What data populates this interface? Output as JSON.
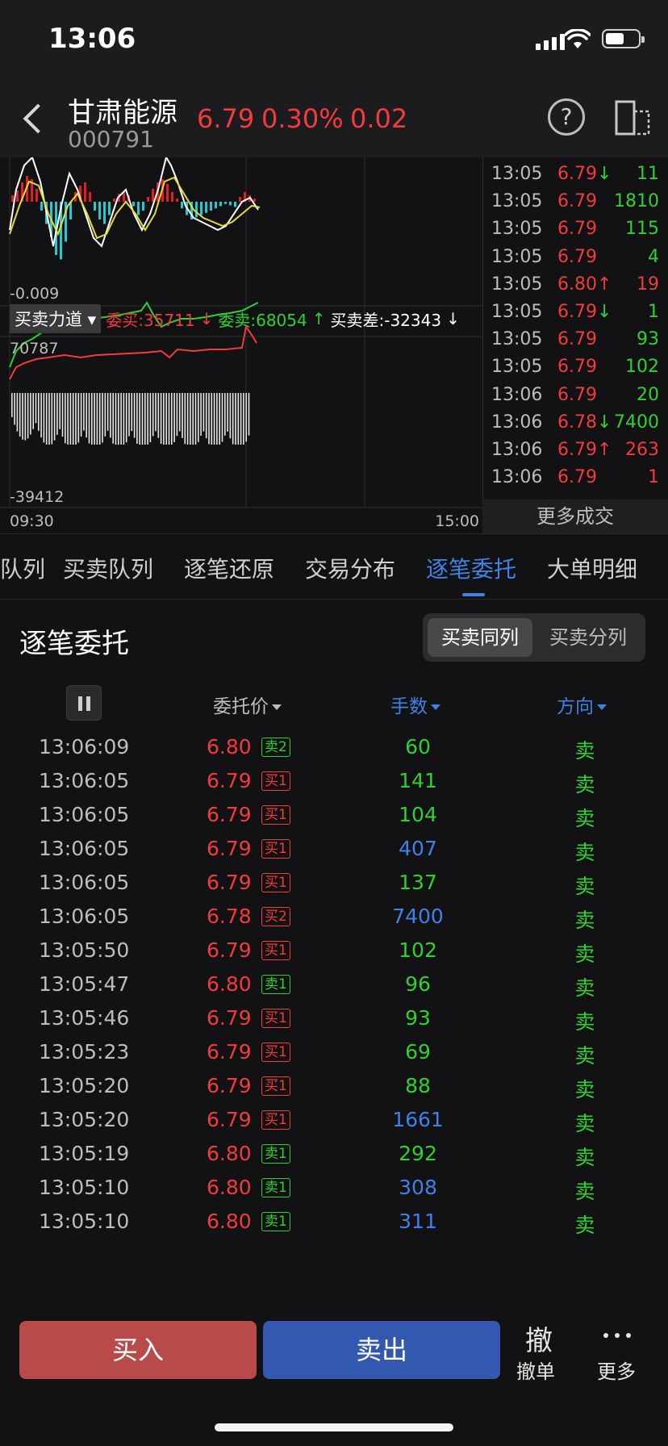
{
  "status_bar": {
    "time": "13:06"
  },
  "header": {
    "stock_name": "甘肃能源",
    "stock_code": "000791",
    "price": "6.79",
    "change_pct": "0.30%",
    "change": "0.02"
  },
  "chart": {
    "macd_min_label": "-0.009",
    "indicator_name": "买卖力道",
    "bid_label": "委买:35711",
    "ask_label": "委卖:68054",
    "diff_label": "买卖差:-32343",
    "power_max_label": "70787",
    "power_min_label": "-39412",
    "time_start": "09:30",
    "time_end": "15:00"
  },
  "ticks": [
    {
      "time": "13:05",
      "price": "6.79",
      "arrow": "↓",
      "vol": "11",
      "price_color": "red",
      "vol_color": "green"
    },
    {
      "time": "13:05",
      "price": "6.79",
      "arrow": "",
      "vol": "1810",
      "price_color": "red",
      "vol_color": "green"
    },
    {
      "time": "13:05",
      "price": "6.79",
      "arrow": "",
      "vol": "115",
      "price_color": "red",
      "vol_color": "green"
    },
    {
      "time": "13:05",
      "price": "6.79",
      "arrow": "",
      "vol": "4",
      "price_color": "red",
      "vol_color": "green"
    },
    {
      "time": "13:05",
      "price": "6.80",
      "arrow": "↑",
      "vol": "19",
      "price_color": "red",
      "vol_color": "red"
    },
    {
      "time": "13:05",
      "price": "6.79",
      "arrow": "↓",
      "vol": "1",
      "price_color": "red",
      "vol_color": "green"
    },
    {
      "time": "13:05",
      "price": "6.79",
      "arrow": "",
      "vol": "93",
      "price_color": "red",
      "vol_color": "green"
    },
    {
      "time": "13:05",
      "price": "6.79",
      "arrow": "",
      "vol": "102",
      "price_color": "red",
      "vol_color": "green"
    },
    {
      "time": "13:06",
      "price": "6.79",
      "arrow": "",
      "vol": "20",
      "price_color": "red",
      "vol_color": "green"
    },
    {
      "time": "13:06",
      "price": "6.78",
      "arrow": "↓",
      "vol": "7400",
      "price_color": "red",
      "vol_color": "green"
    },
    {
      "time": "13:06",
      "price": "6.79",
      "arrow": "↑",
      "vol": "263",
      "price_color": "red",
      "vol_color": "red"
    },
    {
      "time": "13:06",
      "price": "6.79",
      "arrow": "",
      "vol": "1",
      "price_color": "red",
      "vol_color": "red"
    }
  ],
  "more_trades_label": "更多成交",
  "tabs": [
    "队列",
    "买卖队列",
    "逐笔还原",
    "交易分布",
    "逐笔委托",
    "大单明细"
  ],
  "active_tab": "逐笔委托",
  "section": {
    "title": "逐笔委托",
    "seg_a": "买卖同列",
    "seg_b": "买卖分列"
  },
  "table_headers": {
    "price": "委托价",
    "lots": "手数",
    "direction": "方向"
  },
  "orders": [
    {
      "time": "13:06:09",
      "price": "6.80",
      "badge": "卖2",
      "badge_color": "green",
      "lots": "60",
      "lots_color": "green",
      "dir": "卖"
    },
    {
      "time": "13:06:05",
      "price": "6.79",
      "badge": "买1",
      "badge_color": "red",
      "lots": "141",
      "lots_color": "green",
      "dir": "卖"
    },
    {
      "time": "13:06:05",
      "price": "6.79",
      "badge": "买1",
      "badge_color": "red",
      "lots": "104",
      "lots_color": "green",
      "dir": "卖"
    },
    {
      "time": "13:06:05",
      "price": "6.79",
      "badge": "买1",
      "badge_color": "red",
      "lots": "407",
      "lots_color": "blue",
      "dir": "卖"
    },
    {
      "time": "13:06:05",
      "price": "6.79",
      "badge": "买1",
      "badge_color": "red",
      "lots": "137",
      "lots_color": "green",
      "dir": "卖"
    },
    {
      "time": "13:06:05",
      "price": "6.78",
      "badge": "买2",
      "badge_color": "red",
      "lots": "7400",
      "lots_color": "blue",
      "dir": "卖"
    },
    {
      "time": "13:05:50",
      "price": "6.79",
      "badge": "买1",
      "badge_color": "red",
      "lots": "102",
      "lots_color": "green",
      "dir": "卖"
    },
    {
      "time": "13:05:47",
      "price": "6.80",
      "badge": "卖1",
      "badge_color": "green",
      "lots": "96",
      "lots_color": "green",
      "dir": "卖"
    },
    {
      "time": "13:05:46",
      "price": "6.79",
      "badge": "买1",
      "badge_color": "red",
      "lots": "93",
      "lots_color": "green",
      "dir": "卖"
    },
    {
      "time": "13:05:23",
      "price": "6.79",
      "badge": "买1",
      "badge_color": "red",
      "lots": "69",
      "lots_color": "green",
      "dir": "卖"
    },
    {
      "time": "13:05:20",
      "price": "6.79",
      "badge": "买1",
      "badge_color": "red",
      "lots": "88",
      "lots_color": "green",
      "dir": "卖"
    },
    {
      "time": "13:05:20",
      "price": "6.79",
      "badge": "买1",
      "badge_color": "red",
      "lots": "1661",
      "lots_color": "blue",
      "dir": "卖"
    },
    {
      "time": "13:05:19",
      "price": "6.80",
      "badge": "卖1",
      "badge_color": "green",
      "lots": "292",
      "lots_color": "green",
      "dir": "卖"
    },
    {
      "time": "13:05:10",
      "price": "6.80",
      "badge": "卖1",
      "badge_color": "green",
      "lots": "308",
      "lots_color": "blue",
      "dir": "卖"
    },
    {
      "time": "13:05:10",
      "price": "6.80",
      "badge": "卖1",
      "badge_color": "green",
      "lots": "311",
      "lots_color": "blue",
      "dir": "卖"
    }
  ],
  "bottom": {
    "buy": "买入",
    "sell": "卖出",
    "cancel_icon": "撤",
    "cancel_label": "撤单",
    "more_label": "更多"
  },
  "colors": {
    "red": "#f23b3b",
    "green": "#2fd12f",
    "blue": "#3f82e6",
    "buy_btn": "#b94a4a",
    "sell_btn": "#3358b0"
  },
  "icons": [
    "back-arrow-icon",
    "help-icon",
    "layout-switch-icon",
    "pause-icon",
    "caret-down-icon",
    "more-dots-icon"
  ]
}
